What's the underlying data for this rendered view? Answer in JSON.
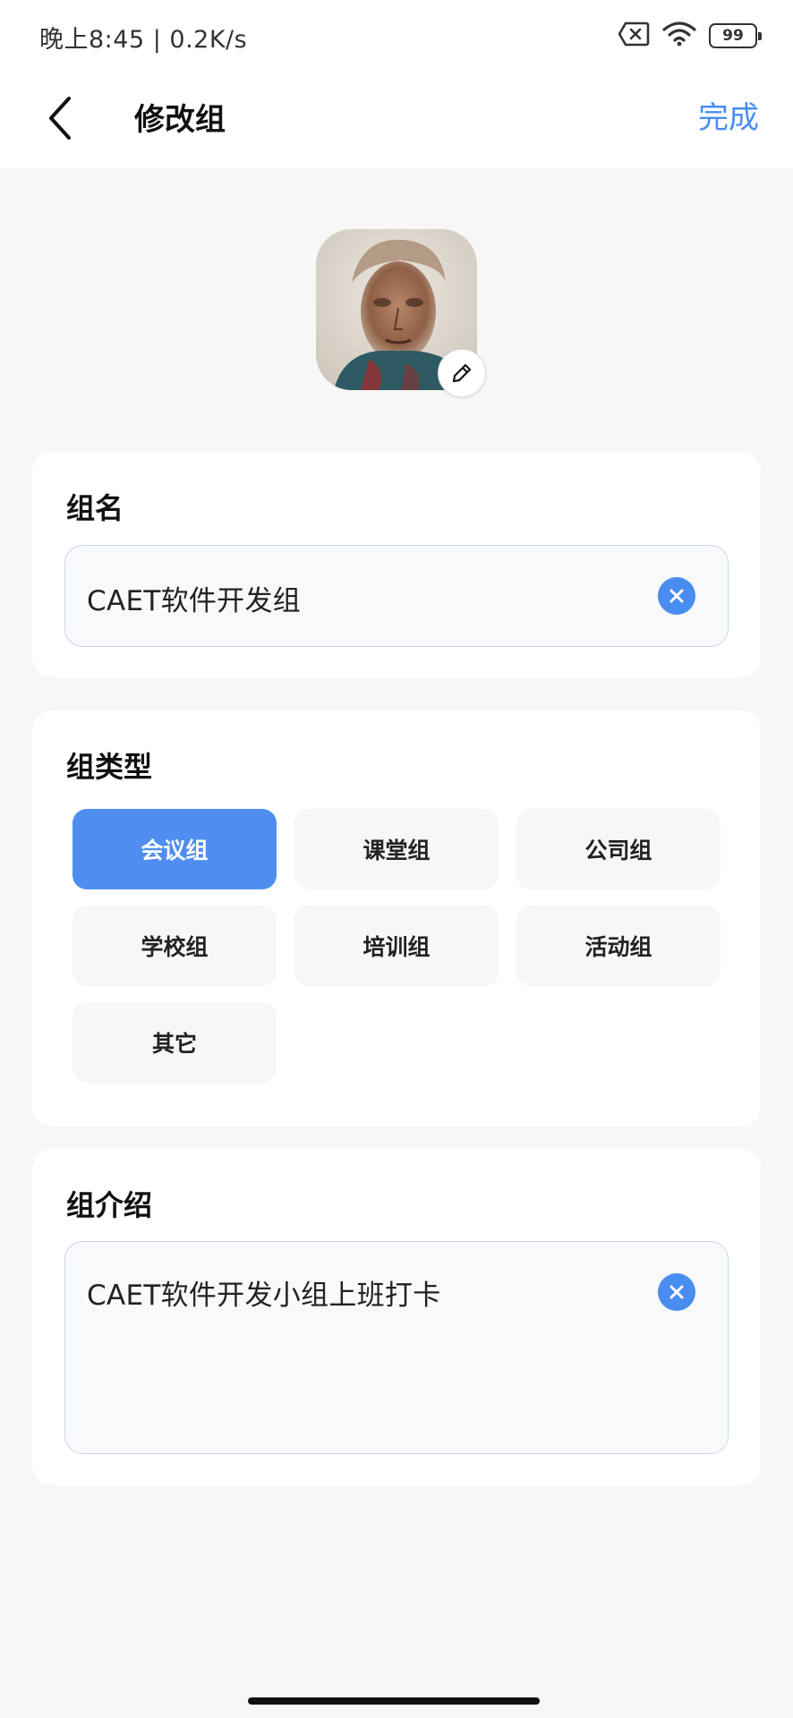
{
  "status_bar": {
    "time_speed": "晚上8:45 | 0.2K/s",
    "battery": "99",
    "icons": [
      "no-sim-icon",
      "wifi-icon",
      "battery-icon"
    ]
  },
  "nav": {
    "title": "修改组",
    "done_label": "完成",
    "accent_color": "#4a8df0"
  },
  "group_name": {
    "label": "组名",
    "value": "CAET软件开发组"
  },
  "group_type": {
    "label": "组类型",
    "selected": "会议组",
    "options": [
      "会议组",
      "课堂组",
      "公司组",
      "学校组",
      "培训组",
      "活动组",
      "其它"
    ]
  },
  "group_intro": {
    "label": "组介绍",
    "value": "CAET软件开发小组上班打卡"
  }
}
